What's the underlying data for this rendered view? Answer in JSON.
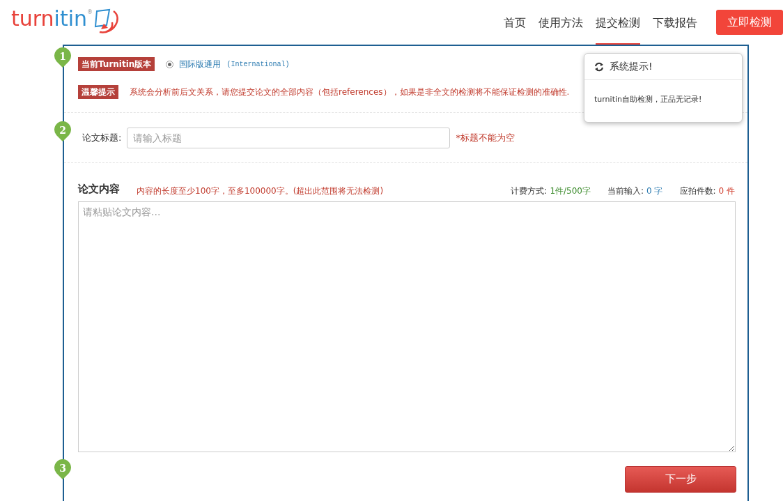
{
  "logo": {
    "parts": [
      {
        "text": "turn",
        "color": "#e8423a"
      },
      {
        "text": "itin",
        "color": "#2f8fd0"
      }
    ],
    "mark": "®"
  },
  "nav": [
    {
      "label": "首页",
      "selected": false
    },
    {
      "label": "使用方法",
      "selected": false
    },
    {
      "label": "提交检测",
      "selected": true
    },
    {
      "label": "下载报告",
      "selected": false
    }
  ],
  "cta_button": "立即检测",
  "step_1": {
    "number": "1",
    "version_label": "当前Turnitin版本",
    "option": {
      "label": "国际版通用",
      "note": "(International)",
      "checked": true
    },
    "tip_label": "温馨提示",
    "tip_text": "系统会分析前后文关系，请您提交论文的全部内容（包括references），如果是非全文的检测将不能保证检测的准确性."
  },
  "popover": {
    "title": "系统提示!",
    "body": "turnitin自助检测，正品无记录!"
  },
  "step_2": {
    "number": "2",
    "title_label": "论文标题:",
    "title_placeholder": "请输入标题",
    "title_error": "*标题不能为空"
  },
  "content": {
    "heading": "论文内容",
    "hint": "内容的长度至少100字，至多100000字。(超出此范围将无法检测)",
    "stats": [
      {
        "label": "计费方式:",
        "value": "1件/500字",
        "color": "#3a8a2a"
      },
      {
        "label": "当前输入:",
        "value": "0 字",
        "color": "#2a7ab0"
      },
      {
        "label": "应拍件数:",
        "value": "0 件",
        "color": "#d03a2a"
      }
    ],
    "placeholder": "请粘贴论文内容..."
  },
  "step_3": {
    "number": "3",
    "next_button": "下一步"
  }
}
